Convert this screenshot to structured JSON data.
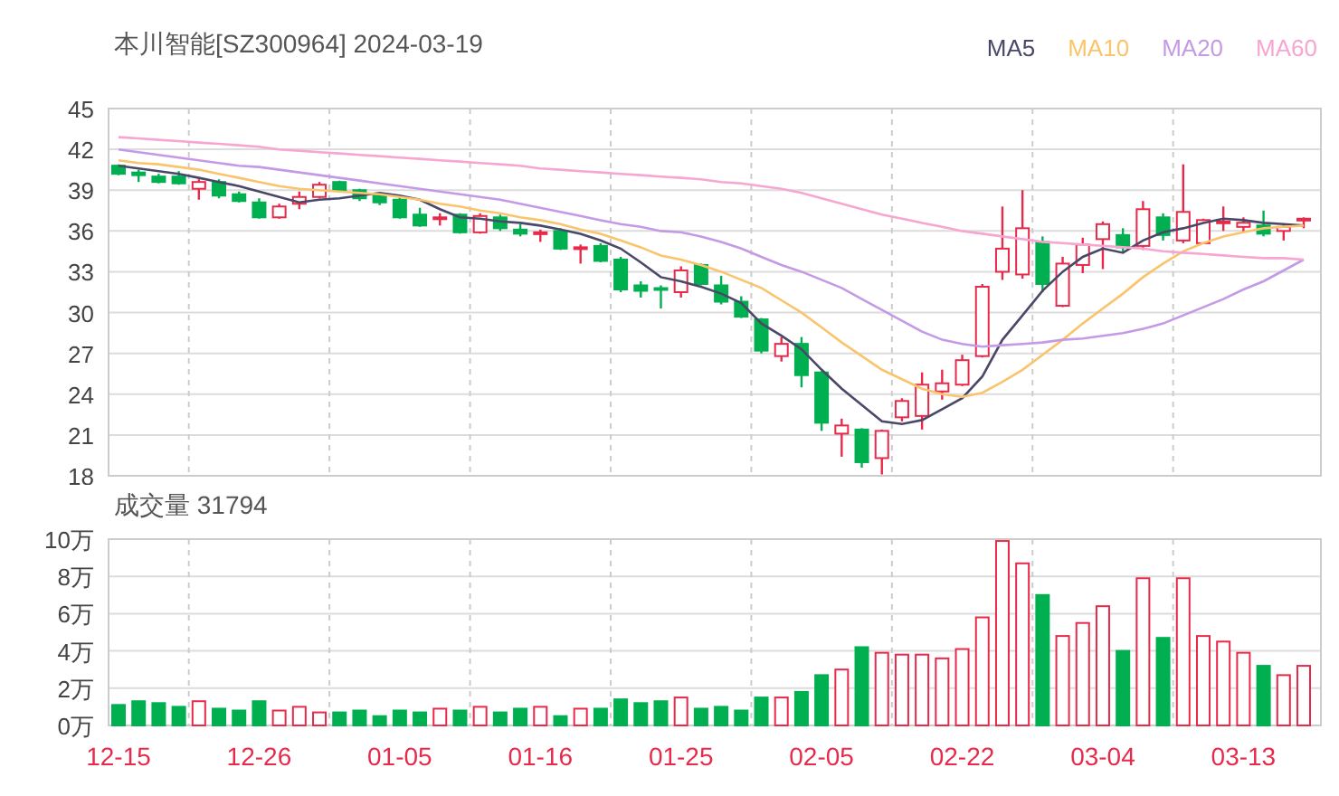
{
  "price_chart": {
    "chart_data": {
      "type": "candlestick",
      "title": "本川智能[SZ300964] 2024-03-19",
      "grid": true,
      "ylim": [
        18,
        45
      ],
      "yticks": [
        18,
        21,
        24,
        27,
        30,
        33,
        36,
        39,
        42,
        45
      ],
      "categories": [
        null,
        null,
        null,
        null,
        null,
        null,
        null,
        null,
        null,
        null,
        null,
        null,
        null,
        null,
        null,
        null,
        null,
        null,
        null,
        null,
        null,
        null,
        null,
        null,
        null,
        null,
        null,
        null,
        null,
        null,
        null,
        null,
        null,
        null,
        null,
        null,
        null,
        null,
        null,
        null,
        null,
        null,
        null,
        null,
        null,
        null,
        null,
        null,
        null,
        null,
        null,
        null,
        null,
        null,
        null,
        null,
        null,
        null,
        null,
        null
      ],
      "ohlc": [
        [
          40.8,
          40.9,
          40.1,
          40.2
        ],
        [
          40.3,
          40.5,
          39.6,
          40.1
        ],
        [
          40.0,
          40.2,
          39.5,
          39.6
        ],
        [
          40.0,
          40.4,
          39.4,
          39.5
        ],
        [
          39.1,
          39.8,
          38.3,
          39.6
        ],
        [
          39.6,
          39.8,
          38.4,
          38.6
        ],
        [
          38.7,
          38.9,
          38.1,
          38.2
        ],
        [
          38.1,
          38.4,
          36.9,
          37.0
        ],
        [
          37.0,
          38.0,
          36.9,
          37.8
        ],
        [
          38.0,
          38.9,
          37.6,
          38.5
        ],
        [
          38.5,
          39.6,
          38.4,
          39.4
        ],
        [
          39.6,
          39.7,
          38.9,
          39.0
        ],
        [
          39.0,
          39.1,
          38.2,
          38.4
        ],
        [
          38.6,
          38.8,
          37.9,
          38.1
        ],
        [
          38.3,
          38.5,
          36.9,
          37.0
        ],
        [
          37.2,
          37.7,
          36.3,
          36.4
        ],
        [
          36.9,
          37.3,
          36.4,
          37.0
        ],
        [
          37.2,
          37.3,
          35.8,
          35.9
        ],
        [
          35.9,
          37.3,
          35.8,
          37.1
        ],
        [
          37.0,
          37.2,
          36.0,
          36.2
        ],
        [
          36.1,
          36.5,
          35.6,
          35.8
        ],
        [
          35.8,
          36.1,
          35.2,
          35.9
        ],
        [
          36.0,
          36.2,
          34.6,
          34.7
        ],
        [
          34.7,
          35.0,
          33.6,
          34.8
        ],
        [
          34.9,
          35.1,
          33.7,
          33.8
        ],
        [
          33.9,
          34.1,
          31.5,
          31.7
        ],
        [
          32.0,
          32.3,
          31.1,
          31.6
        ],
        [
          31.8,
          32.0,
          30.3,
          31.7
        ],
        [
          31.5,
          33.4,
          31.1,
          33.1
        ],
        [
          33.5,
          33.6,
          32.0,
          32.1
        ],
        [
          32.0,
          32.7,
          30.6,
          30.8
        ],
        [
          30.8,
          31.2,
          29.6,
          29.7
        ],
        [
          29.5,
          29.6,
          27.0,
          27.2
        ],
        [
          26.8,
          28.2,
          26.4,
          27.7
        ],
        [
          27.7,
          28.2,
          24.5,
          25.4
        ],
        [
          25.6,
          25.7,
          21.3,
          21.9
        ],
        [
          21.1,
          22.2,
          19.4,
          21.7
        ],
        [
          21.4,
          21.5,
          18.6,
          19.0
        ],
        [
          19.3,
          21.4,
          18.1,
          21.3
        ],
        [
          22.3,
          23.7,
          22.0,
          23.5
        ],
        [
          22.4,
          25.6,
          21.4,
          24.7
        ],
        [
          24.2,
          25.8,
          23.6,
          24.8
        ],
        [
          24.7,
          26.9,
          24.6,
          26.5
        ],
        [
          26.8,
          32.1,
          26.7,
          31.9
        ],
        [
          33.0,
          37.8,
          32.4,
          34.7
        ],
        [
          32.8,
          39.0,
          32.5,
          36.2
        ],
        [
          35.2,
          35.6,
          31.5,
          32.1
        ],
        [
          30.5,
          34.1,
          30.4,
          33.6
        ],
        [
          33.5,
          35.5,
          32.9,
          35.0
        ],
        [
          35.4,
          36.7,
          33.2,
          36.5
        ],
        [
          35.7,
          36.2,
          34.5,
          34.8
        ],
        [
          34.9,
          38.2,
          34.6,
          37.6
        ],
        [
          37.0,
          37.3,
          35.3,
          35.7
        ],
        [
          35.3,
          40.9,
          35.1,
          37.4
        ],
        [
          35.1,
          36.9,
          35.1,
          36.8
        ],
        [
          36.6,
          37.8,
          36.0,
          36.7
        ],
        [
          36.3,
          37.0,
          35.9,
          36.6
        ],
        [
          36.4,
          37.5,
          35.6,
          35.8
        ],
        [
          36.0,
          36.4,
          35.3,
          36.3
        ],
        [
          36.8,
          37.0,
          36.2,
          36.9
        ]
      ]
    }
  },
  "moving_averages": {
    "chart_data": {
      "type": "line",
      "ylim": [
        18,
        45
      ],
      "categories": [
        null,
        null,
        null,
        null,
        null,
        null,
        null,
        null,
        null,
        null,
        null,
        null,
        null,
        null,
        null,
        null,
        null,
        null,
        null,
        null,
        null,
        null,
        null,
        null,
        null,
        null,
        null,
        null,
        null,
        null,
        null,
        null,
        null,
        null,
        null,
        null,
        null,
        null,
        null,
        null,
        null,
        null,
        null,
        null,
        null,
        null,
        null,
        null,
        null,
        null,
        null,
        null,
        null,
        null,
        null,
        null,
        null,
        null,
        null,
        null
      ],
      "series": [
        {
          "name": "MA5",
          "color": "#4a4868",
          "values": [
            40.8,
            40.6,
            40.4,
            40.2,
            39.9,
            39.6,
            39.3,
            38.9,
            38.5,
            38.1,
            38.3,
            38.4,
            38.6,
            38.8,
            38.6,
            38.3,
            37.6,
            37.0,
            36.9,
            36.7,
            36.6,
            36.4,
            36.1,
            35.8,
            35.3,
            34.7,
            33.7,
            32.6,
            32.3,
            31.9,
            31.4,
            30.7,
            29.2,
            28.3,
            27.3,
            25.8,
            24.4,
            23.2,
            22.0,
            21.8,
            22.1,
            22.9,
            23.7,
            25.3,
            28.0,
            29.8,
            31.6,
            33.0,
            34.1,
            34.7,
            34.4,
            35.3,
            35.9,
            36.2,
            36.6,
            36.9,
            36.8,
            36.6,
            36.5,
            36.4
          ]
        },
        {
          "name": "MA10",
          "color": "#f9c46b",
          "values": [
            41.2,
            41.0,
            40.9,
            40.7,
            40.5,
            40.2,
            39.9,
            39.6,
            39.3,
            39.1,
            39.0,
            38.9,
            38.8,
            38.7,
            38.5,
            38.3,
            38.0,
            37.8,
            37.5,
            37.3,
            37.0,
            36.8,
            36.5,
            36.1,
            35.8,
            35.3,
            34.8,
            34.2,
            33.9,
            33.5,
            33.0,
            32.4,
            31.8,
            30.9,
            30.0,
            28.9,
            27.8,
            26.8,
            25.8,
            25.1,
            24.4,
            24.0,
            23.8,
            24.1,
            24.9,
            25.8,
            26.9,
            28.0,
            29.2,
            30.3,
            31.4,
            32.6,
            33.6,
            34.5,
            35.1,
            35.6,
            35.9,
            36.2,
            36.3,
            36.4
          ]
        },
        {
          "name": "MA20",
          "color": "#c49ae6",
          "values": [
            42.0,
            41.8,
            41.6,
            41.4,
            41.2,
            41.0,
            40.8,
            40.7,
            40.5,
            40.3,
            40.1,
            39.9,
            39.7,
            39.5,
            39.3,
            39.1,
            38.9,
            38.7,
            38.5,
            38.3,
            38.0,
            37.7,
            37.4,
            37.1,
            36.8,
            36.5,
            36.3,
            36.0,
            35.9,
            35.6,
            35.2,
            34.7,
            34.1,
            33.5,
            33.0,
            32.4,
            31.8,
            31.0,
            30.2,
            29.4,
            28.6,
            28.0,
            27.7,
            27.5,
            27.6,
            27.7,
            27.8,
            28.0,
            28.1,
            28.3,
            28.5,
            28.8,
            29.2,
            29.8,
            30.4,
            31.0,
            31.7,
            32.3,
            33.1,
            33.9
          ]
        },
        {
          "name": "MA60",
          "color": "#f6a6d0",
          "values": [
            42.9,
            42.8,
            42.7,
            42.6,
            42.5,
            42.4,
            42.3,
            42.2,
            42.0,
            41.9,
            41.8,
            41.7,
            41.6,
            41.5,
            41.4,
            41.3,
            41.2,
            41.1,
            41.0,
            40.9,
            40.8,
            40.6,
            40.5,
            40.4,
            40.3,
            40.2,
            40.1,
            40.0,
            39.9,
            39.8,
            39.6,
            39.5,
            39.3,
            39.1,
            38.8,
            38.4,
            38.0,
            37.6,
            37.2,
            36.9,
            36.6,
            36.3,
            36.0,
            35.8,
            35.6,
            35.4,
            35.2,
            35.1,
            35.0,
            34.9,
            34.8,
            34.7,
            34.5,
            34.4,
            34.3,
            34.2,
            34.1,
            34.0,
            34.0,
            33.9
          ]
        }
      ]
    }
  },
  "volume_chart": {
    "chart_data": {
      "type": "bar",
      "title": "成交量 31794",
      "grid": true,
      "ylim": [
        0,
        10
      ],
      "yticks": [
        {
          "value": 0,
          "label": "0万"
        },
        {
          "value": 2,
          "label": "2万"
        },
        {
          "value": 4,
          "label": "4万"
        },
        {
          "value": 6,
          "label": "6万"
        },
        {
          "value": 8,
          "label": "8万"
        },
        {
          "value": 10,
          "label": "10万"
        }
      ],
      "categories": [
        "12-15",
        null,
        null,
        null,
        null,
        null,
        null,
        "12-26",
        null,
        null,
        null,
        null,
        null,
        null,
        "01-05",
        null,
        null,
        null,
        null,
        null,
        null,
        "01-16",
        null,
        null,
        null,
        null,
        null,
        null,
        "01-25",
        null,
        null,
        null,
        null,
        null,
        null,
        "02-05",
        null,
        null,
        null,
        null,
        null,
        null,
        "02-22",
        null,
        null,
        null,
        null,
        null,
        null,
        "03-04",
        null,
        null,
        null,
        null,
        null,
        null,
        "03-13",
        null,
        null,
        null
      ],
      "values": [
        1.1,
        1.3,
        1.2,
        1.0,
        1.3,
        0.9,
        0.8,
        1.3,
        0.8,
        1.0,
        0.7,
        0.7,
        0.8,
        0.5,
        0.8,
        0.7,
        0.9,
        0.8,
        1.0,
        0.7,
        0.9,
        1.0,
        0.5,
        0.9,
        0.9,
        1.4,
        1.2,
        1.3,
        1.5,
        0.9,
        1.0,
        0.8,
        1.5,
        1.5,
        1.8,
        2.7,
        3.0,
        4.2,
        3.9,
        3.8,
        3.8,
        3.6,
        4.1,
        5.8,
        9.9,
        8.7,
        7.0,
        4.8,
        5.5,
        6.4,
        4.0,
        7.9,
        4.7,
        7.9,
        4.8,
        4.5,
        3.9,
        3.2,
        2.7,
        3.2
      ]
    }
  }
}
